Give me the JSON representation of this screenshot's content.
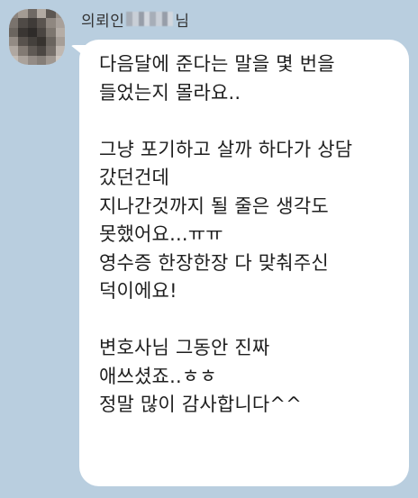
{
  "chat": {
    "sender": {
      "name_prefix": "의뢰인",
      "name_suffix": "님"
    },
    "message": {
      "lines": [
        "다음달에 준다는 말을 몇 번을",
        "들었는지 몰라요..",
        "",
        "그냥 포기하고 살까 하다가 상담",
        "갔던건데",
        "지나간것까지 될 줄은 생각도",
        "못했어요...ㅠㅠ",
        "영수증 한장한장 다 맞춰주신",
        "덕이에요!",
        "",
        "변호사님 그동안 진짜",
        "애쓰셨죠..ㅎㅎ",
        "정말 많이 감사합니다^^"
      ]
    }
  },
  "colors": {
    "chat_background": "#b9cedf",
    "bubble_background": "#ffffff",
    "message_text": "#1e1e1e"
  }
}
